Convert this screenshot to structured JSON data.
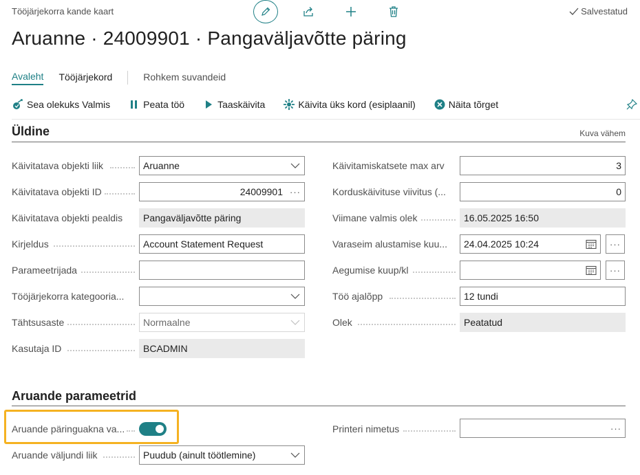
{
  "header": {
    "caption": "Tööjärjekorra kande kaart",
    "title": "Aruanne · 24009901 · Pangaväljavõtte päring",
    "saved_label": "Salvestatud"
  },
  "tabs": [
    {
      "label": "Avaleht",
      "active": true
    },
    {
      "label": "Tööjärjekord",
      "active": false
    },
    {
      "label": "Rohkem suvandeid",
      "active": false
    }
  ],
  "actions": {
    "set_ready": "Sea olekuks Valmis",
    "pause": "Peata töö",
    "restart": "Taaskäivita",
    "run_once": "Käivita üks kord (esiplaanil)",
    "show_errors": "Näita tõrget"
  },
  "general": {
    "title": "Üldine",
    "show_less": "Kuva vähem",
    "left": [
      {
        "label": "Käivitatava objekti liik",
        "value": "Aruanne"
      },
      {
        "label": "Käivitatava objekti ID",
        "value": "24009901"
      },
      {
        "label": "Käivitatava objekti pealdis",
        "value": "Pangaväljavõtte päring"
      },
      {
        "label": "Kirjeldus",
        "value": "Account Statement Request"
      },
      {
        "label": "Parameetrijada",
        "value": ""
      },
      {
        "label": "Tööjärjekorra kategooria...",
        "value": ""
      },
      {
        "label": "Tähtsusaste",
        "value": "Normaalne"
      },
      {
        "label": "Kasutaja ID",
        "value": "BCADMIN"
      }
    ],
    "right": [
      {
        "label": "Käivitamiskatsete max arv",
        "value": "3"
      },
      {
        "label": "Korduskäivituse viivitus (...",
        "value": "0"
      },
      {
        "label": "Viimane valmis olek",
        "value": "16.05.2025 16:50"
      },
      {
        "label": "Varaseim alustamise kuu...",
        "value": "24.04.2025 10:24"
      },
      {
        "label": "Aegumise kuup/kl",
        "value": ""
      },
      {
        "label": "Töö ajalõpp",
        "value": "12 tundi"
      },
      {
        "label": "Olek",
        "value": "Peatatud"
      }
    ]
  },
  "report_params": {
    "title": "Aruande parameetrid",
    "request_window_label": "Aruande päringuakna va...",
    "request_window_on": true,
    "output_type_label": "Aruande väljundi liik",
    "output_type_value": "Puudub (ainult töötlemine)",
    "printer_label": "Printeri nimetus",
    "printer_value": ""
  },
  "colors": {
    "accent": "#1f8086",
    "highlight": "#f5b221"
  }
}
